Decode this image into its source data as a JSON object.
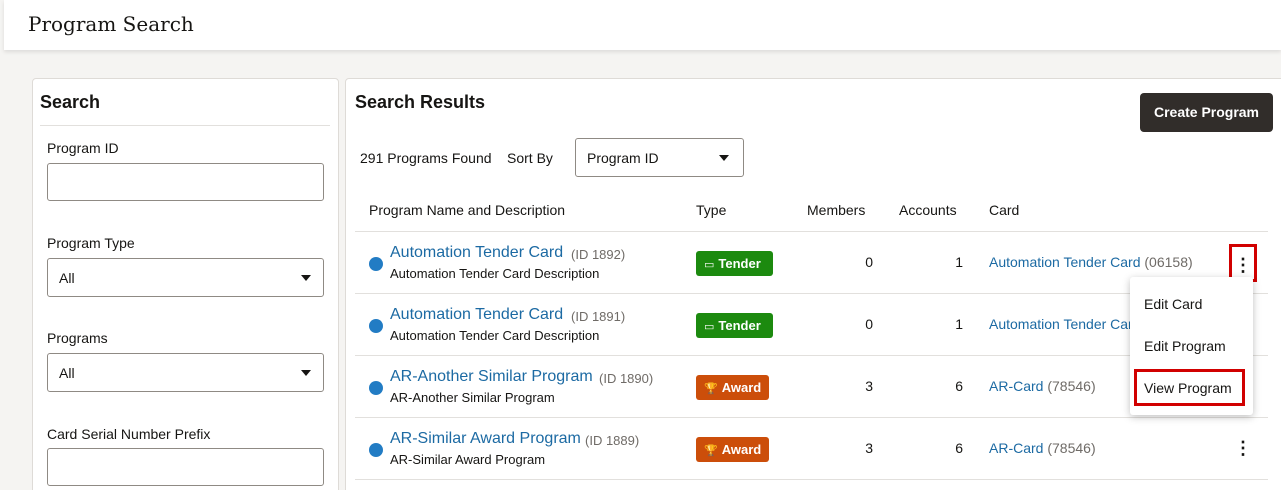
{
  "page": {
    "title": "Program Search"
  },
  "search": {
    "heading": "Search",
    "program_id_label": "Program ID",
    "program_id_value": "",
    "program_type_label": "Program Type",
    "program_type_value": "All",
    "programs_label": "Programs",
    "programs_value": "All",
    "card_prefix_label": "Card Serial Number Prefix",
    "card_prefix_value": ""
  },
  "results": {
    "title": "Search Results",
    "create_label": "Create Program",
    "found_text": "291 Programs Found",
    "sort_label": "Sort By",
    "sort_value": "Program ID",
    "columns": [
      "Program Name and Description",
      "Type",
      "Members",
      "Accounts",
      "Card"
    ],
    "rows": [
      {
        "name": "Automation Tender Card",
        "id": "(ID 1892)",
        "desc": "Automation Tender Card Description",
        "type": "Tender",
        "members": "0",
        "accounts": "1",
        "card": "Automation Tender Card",
        "serial": "(06158)"
      },
      {
        "name": "Automation Tender Card",
        "id": "(ID 1891)",
        "desc": "Automation Tender Card Description",
        "type": "Tender",
        "members": "0",
        "accounts": "1",
        "card": "Automation Tender Card",
        "serial": ""
      },
      {
        "name": "AR-Another Similar Program",
        "id": "(ID 1890)",
        "desc": "AR-Another Similar Program",
        "type": "Award",
        "members": "3",
        "accounts": "6",
        "card": "AR-Card",
        "serial": "(78546)"
      },
      {
        "name": "AR-Similar Award Program",
        "id": "(ID 1889)",
        "desc": "AR-Similar Award Program",
        "type": "Award",
        "members": "3",
        "accounts": "6",
        "card": "AR-Card",
        "serial": "(78546)"
      }
    ]
  },
  "menu": {
    "items": [
      "Edit Card",
      "Edit Program",
      "View Program"
    ]
  },
  "colors": {
    "tender": "#1c8a0f",
    "award": "#cc4e0a",
    "link": "#1c6aa3",
    "highlight": "#d10000",
    "primary_button": "#312d2a"
  }
}
